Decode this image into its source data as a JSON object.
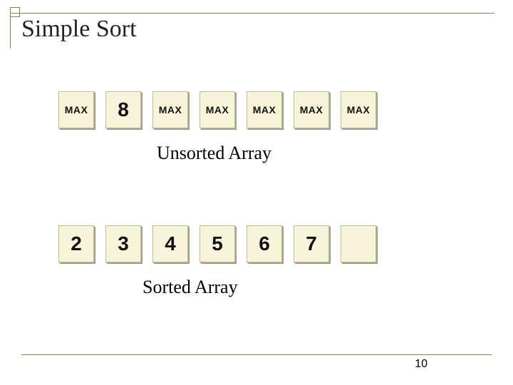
{
  "title": "Simple Sort",
  "unsorted": {
    "cells": [
      {
        "kind": "max",
        "text": "MAX"
      },
      {
        "kind": "num",
        "text": "8"
      },
      {
        "kind": "max",
        "text": "MAX"
      },
      {
        "kind": "max",
        "text": "MAX"
      },
      {
        "kind": "max",
        "text": "MAX"
      },
      {
        "kind": "max",
        "text": "MAX"
      },
      {
        "kind": "max",
        "text": "MAX"
      }
    ],
    "caption": "Unsorted Array"
  },
  "sorted": {
    "cells": [
      {
        "kind": "num",
        "text": "2"
      },
      {
        "kind": "num",
        "text": "3"
      },
      {
        "kind": "num",
        "text": "4"
      },
      {
        "kind": "num",
        "text": "5"
      },
      {
        "kind": "num",
        "text": "6"
      },
      {
        "kind": "num",
        "text": "7"
      },
      {
        "kind": "empty",
        "text": ""
      }
    ],
    "caption": "Sorted Array"
  },
  "page_number": "10"
}
